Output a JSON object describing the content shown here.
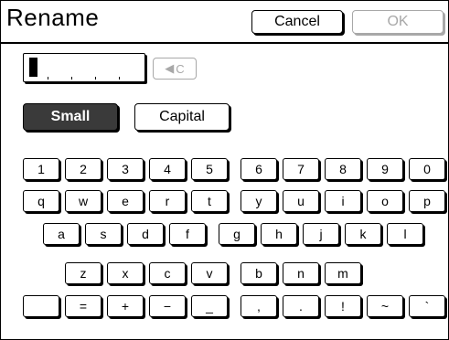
{
  "header": {
    "title": "Rename",
    "cancel_label": "Cancel",
    "ok_label": "OK"
  },
  "input": {
    "value": ""
  },
  "backspace": {
    "label": "C",
    "icon": "backspace-arrow-icon"
  },
  "case_toggle": {
    "small_label": "Small",
    "capital_label": "Capital",
    "selected": "Small"
  },
  "keyboard": {
    "row1": [
      "1",
      "2",
      "3",
      "4",
      "5",
      "6",
      "7",
      "8",
      "9",
      "0"
    ],
    "row2": [
      "q",
      "w",
      "e",
      "r",
      "t",
      "y",
      "u",
      "i",
      "o",
      "p"
    ],
    "row3": [
      "a",
      "s",
      "d",
      "f",
      "g",
      "h",
      "j",
      "k",
      "l"
    ],
    "row4": [
      "z",
      "x",
      "c",
      "v",
      "b",
      "n",
      "m"
    ],
    "row5": [
      " ",
      "=",
      "+",
      "−",
      "_",
      ",",
      ".",
      "!",
      "~",
      "`"
    ]
  }
}
